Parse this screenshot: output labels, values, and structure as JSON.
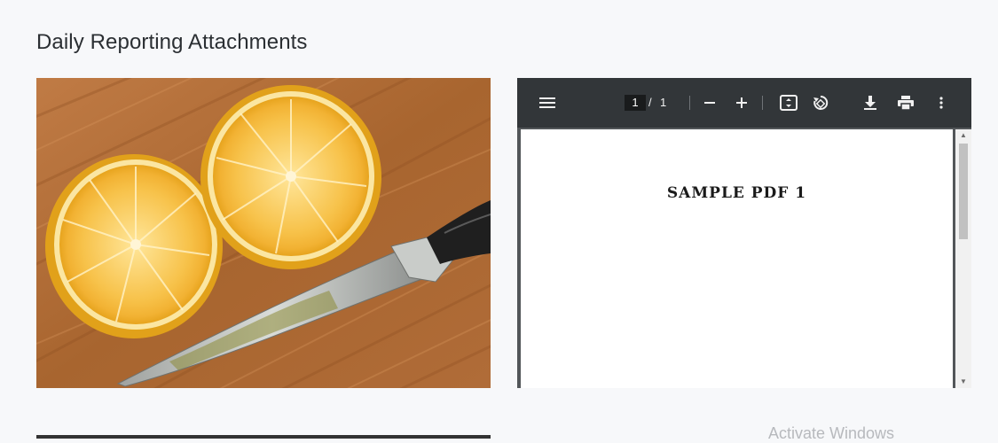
{
  "page": {
    "title": "Daily Reporting Attachments"
  },
  "attachments": {
    "image": {
      "description_icon": "lemon-photo"
    },
    "pdf": {
      "toolbar": {
        "menu_icon": "menu-icon",
        "current_page": "1",
        "page_separator": "/",
        "total_pages": "1",
        "zoom_out_icon": "minus-icon",
        "zoom_in_icon": "plus-icon",
        "fit_icon": "fit-page-icon",
        "rotate_icon": "rotate-icon",
        "download_icon": "download-icon",
        "print_icon": "print-icon",
        "more_icon": "more-vertical-icon"
      },
      "page_text": "SAMPLE PDF 1"
    }
  },
  "os": {
    "watermark": "Activate Windows"
  },
  "colors": {
    "toolbar": "#323639",
    "viewer_bg": "#525659",
    "page_bg": "#f7f8fa"
  }
}
